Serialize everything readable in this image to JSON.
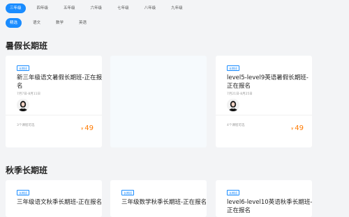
{
  "grades": [
    "三年级",
    "四年级",
    "五年级",
    "六年级",
    "七年级",
    "八年级",
    "九年级"
  ],
  "subjects": [
    "精选",
    "语文",
    "数学",
    "英语"
  ],
  "sections": [
    {
      "title": "暑假长期班",
      "cards": [
        {
          "badge": "长期班",
          "title": "新三年级语文暑假长期班-正在报名",
          "date": "7月7日-8月11日",
          "selectable": "3个课程可选",
          "currency": "¥",
          "price": "49"
        },
        {
          "badge": "长期班",
          "title": "level5-level9英语暑假长期班-正在报名",
          "date": "7月21日-8月25日",
          "selectable": "4个课程可选",
          "currency": "¥",
          "price": "49"
        }
      ]
    },
    {
      "title": "秋季长期班",
      "cards": [
        {
          "badge": "长期班",
          "title": "三年级语文秋季长期班-正在报名"
        },
        {
          "badge": "长期班",
          "title": "三年级数学秋季长期班-正在报名"
        },
        {
          "badge": "长期班",
          "title": "level6-level10英语秋季长期班-正在报名"
        }
      ]
    }
  ],
  "colors": {
    "accent": "#1a8cff",
    "price": "#ff7a00"
  }
}
